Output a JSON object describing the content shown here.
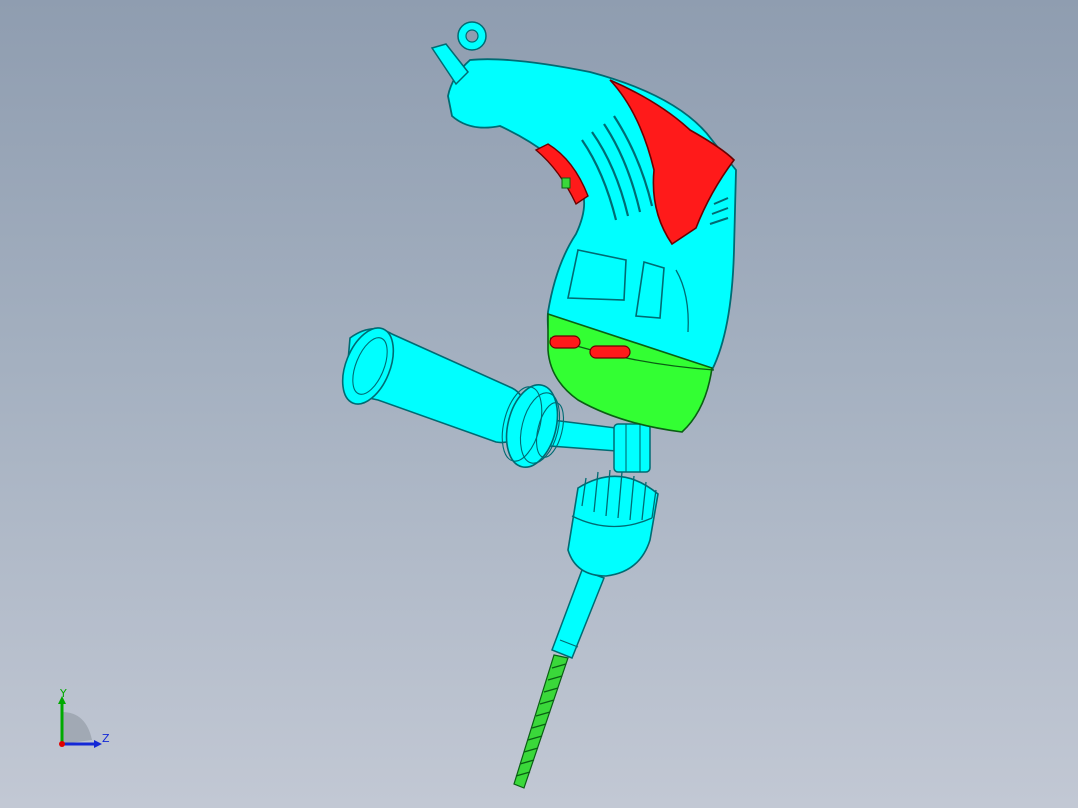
{
  "viewport": {
    "background_top": "#8f9db0",
    "background_bottom": "#c2c8d4"
  },
  "model": {
    "part": "power-drill",
    "colors": {
      "body": "#00ffff",
      "body_edge": "#006b73",
      "accent": "#ff1a1a",
      "gear_housing": "#33ff33",
      "drill_bit": "#3ad83a"
    }
  },
  "triad": {
    "y_label": "Y",
    "z_label": "Z",
    "y_color": "#00aa00",
    "z_color": "#1428d6",
    "origin_color": "#e00000"
  }
}
